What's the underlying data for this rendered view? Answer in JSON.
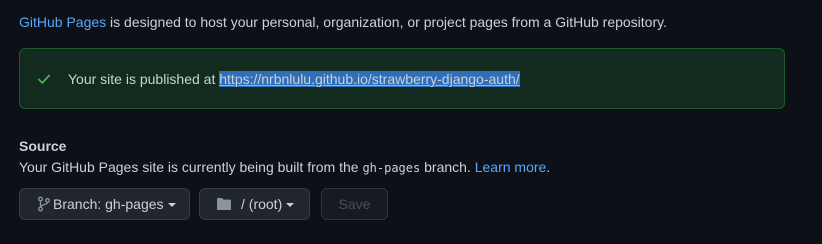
{
  "intro": {
    "link": "GitHub Pages",
    "text": " is designed to host your personal, organization, or project pages from a GitHub repository."
  },
  "flash": {
    "icon": "check-icon",
    "message": "Your site is published at ",
    "url": "https://nrbnlulu.github.io/strawberry-django-auth/"
  },
  "source": {
    "title": "Source",
    "desc_before": "Your GitHub Pages site is currently being built from the ",
    "branch_code": "gh-pages",
    "desc_after": " branch. ",
    "learn_more": "Learn more",
    "period": "."
  },
  "controls": {
    "branch_label": "Branch: gh-pages",
    "folder_label": "/ (root)",
    "save_label": "Save"
  },
  "colors": {
    "background": "#0d1117",
    "link": "#58a6ff",
    "success": "#3fb950"
  }
}
